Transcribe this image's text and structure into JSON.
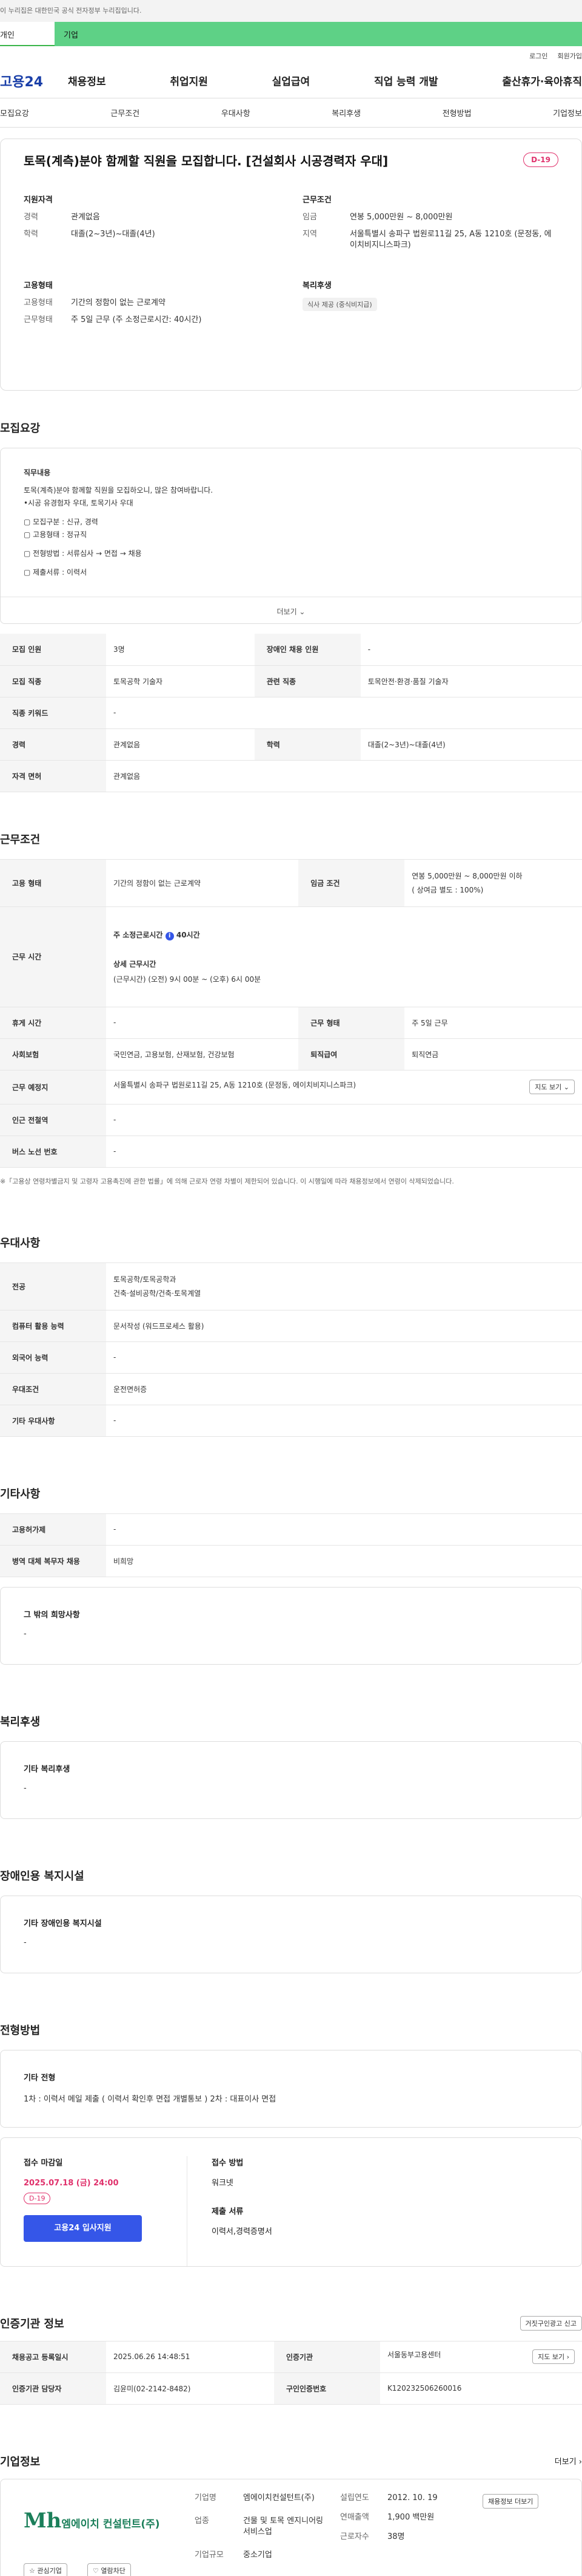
{
  "notice": "이 누리집은 대한민국 공식 전자정부 누리집입니다.",
  "user_tabs": [
    "개인",
    "기업"
  ],
  "util": [
    "로그인",
    "회원가입"
  ],
  "logo": "고용24",
  "gnb": [
    "채용정보",
    "취업지원",
    "실업급여",
    "직업 능력 개발",
    "출산휴가·육아휴직"
  ],
  "subnav": [
    "모집요강",
    "근무조건",
    "우대사항",
    "복리후생",
    "전형방법",
    "기업정보"
  ],
  "job": {
    "title": "토목(계측)분야 함께할 직원을 모집합니다. [건설회사 시공경력자 우대]",
    "dday": "D-19",
    "qual_head": "지원자격",
    "career_k": "경력",
    "career_v": "관계없음",
    "edu_k": "학력",
    "edu_v": "대졸(2~3년)~대졸(4년)",
    "cond_head": "근무조건",
    "pay_k": "임금",
    "pay_v": "연봉 5,000만원 ~ 8,000만원",
    "loc_k": "지역",
    "loc_v": "서울특별시 송파구 법원로11길 25, A동 1210호 (문정동, 에이치비지니스파크)",
    "emp_head": "고용형태",
    "emp_k": "고용형태",
    "emp_v": "기간의 정함이 없는 근로계약",
    "work_k": "근무형태",
    "work_v": "주 5일 근무 (주 소정근로시간: 40시간)",
    "welfare_head": "복리후생",
    "welfare_chip": "식사 제공 (중식비지급)"
  },
  "recruit": {
    "title": "모집요강",
    "box_head": "직무내용",
    "lines": [
      "토목(계측)분야 함께할 직원을 모집하오니, 많은 참여바랍니다.",
      "•시공 유경험자 우대, 토목기사 우대",
      "",
      "▢ 모집구분 : 신규, 경력",
      "▢ 고용형태 : 정규직",
      "",
      "▢ 전형방법 : 서류심사 → 면접 → 채용",
      "",
      "▢ 제출서류 : 이력서"
    ],
    "more": "더보기 ⌄",
    "rows": [
      [
        "모집 인원",
        "3명",
        "장애인 채용 인원",
        "-"
      ],
      [
        "모집 직종",
        "토목공학 기술자",
        "관련 직종",
        "토목안전·환경·품질 기술자"
      ],
      [
        "직종 키워드",
        "-"
      ],
      [
        "경력",
        "관계없음",
        "학력",
        "대졸(2~3년)~대졸(4년)"
      ],
      [
        "자격 면허",
        "관계없음"
      ]
    ]
  },
  "conditions": {
    "title": "근무조건",
    "emp_k": "고용 형태",
    "emp_v": "기간의 정함이 없는 근로계약",
    "pay_k": "임금 조건",
    "pay_v1": "연봉 5,000만원 ~ 8,000만원 이하",
    "pay_v2": "( 상여금 별도 : 100%)",
    "time_k": "근무 시간",
    "time_l1": "주 소정근로시간",
    "time_l1b": "40시간",
    "time_l2": "상세 근무시간",
    "time_l3": "(근무시간) (오전) 9시 00분 ~ (오후) 6시 00분",
    "holiday_k": "휴게 시간",
    "holiday_v": "-",
    "worktype_k": "근무 형태",
    "worktype_v": "주 5일 근무",
    "ins_k": "사회보험",
    "ins_v": "국민연금, 고용보험, 산재보험, 건강보험",
    "ret_k": "퇴직급여",
    "ret_v": "퇴직연금",
    "addr_k": "근무 예정지",
    "addr_v": "서울특별시 송파구 법원로11길 25, A동 1210호 (문정동, 에이치비지니스파크)",
    "map_btn": "지도 보기 ⌄",
    "sub_k": "인근 전철역",
    "sub_v": "-",
    "bus_k": "버스 노선 번호",
    "bus_v": "-",
    "note": "※「고용상 연령차별금지 및 고령자 고용촉진에 관한 법률」에 의해 근로자 연령 차별이 제한되어 있습니다. 이 시행일에 따라 채용정보에서 연령이 삭제되었습니다."
  },
  "prefer": {
    "title": "우대사항",
    "rows": [
      [
        "전공",
        "토목공학/토목공학과",
        "건축·설비공학/건축·토목계열"
      ],
      [
        "컴퓨터 활용 능력",
        "문서작성 (워드프로세스 활용)"
      ],
      [
        "외국어 능력",
        "-"
      ],
      [
        "우대조건",
        "운전면허증"
      ],
      [
        "기타 우대사항",
        "-"
      ]
    ]
  },
  "etc": {
    "title": "기타사항",
    "rows": [
      [
        "고용허가제",
        "-"
      ],
      [
        "병역 대체 복무자 채용",
        "비희망"
      ]
    ],
    "box_h": "그 밖의 희망사항",
    "box_v": "-"
  },
  "welfare": {
    "title": "복리후생",
    "box_h": "기타 복리후생",
    "box_v": "-"
  },
  "disabled": {
    "title": "장애인용 복지시설",
    "box_h": "기타 장애인용 복지시설",
    "box_v": "-"
  },
  "screening": {
    "title": "전형방법",
    "box_h": "기타 전형",
    "box_v": "1차 : 이력서 메일 제출 ( 이력서 확인후 면접 개별통보 ) 2차 : 대표이사 면접"
  },
  "apply": {
    "deadline_k": "접수 마감일",
    "deadline_v": "2025.07.18 (금) 24:00",
    "dday": "D-19",
    "btn": "고용24 입사지원",
    "method_k": "접수 방법",
    "method_v": "워크넷",
    "docs_k": "제출 서류",
    "docs_v": "이력서,경력증명서"
  },
  "agency": {
    "title": "인증기관 정보",
    "report_btn": "거짓구인광고 신고",
    "reg_k": "채용공고 등록일시",
    "reg_v": "2025.06.26 14:48:51",
    "org_k": "인증기관",
    "org_v": "서울동부고용센터",
    "map_btn": "지도 보기 ›",
    "mgr_k": "인증기관 담당자",
    "mgr_v": "김윤미(02-2142-8482)",
    "no_k": "구인인증번호",
    "no_v": "K120232506260016"
  },
  "company": {
    "title": "기업정보",
    "more": "더보기 ›",
    "logo_text": "엠에이치 컨설턴트(주)",
    "fav_btn": "☆ 관심기업",
    "follow_btn": "♡ 열람차단",
    "name_k": "기업명",
    "name_v": "엠에이치컨설턴트(주)",
    "ind_k": "업종",
    "ind_v": "건물 및 토목 엔지니어링 서비스업",
    "size_k": "기업규모",
    "size_v": "중소기업",
    "est_k": "설립연도",
    "est_v": "2012. 10. 19",
    "sales_k": "연매출액",
    "sales_v": "1,900 백만원",
    "emp_k": "근로자수",
    "emp_v": "38명",
    "view_btn": "채용정보 더보기"
  },
  "colors": {
    "accent": "#3556e8",
    "dday": "#e0306b",
    "green": "#5ed186",
    "logo": "#1a3fa8"
  }
}
